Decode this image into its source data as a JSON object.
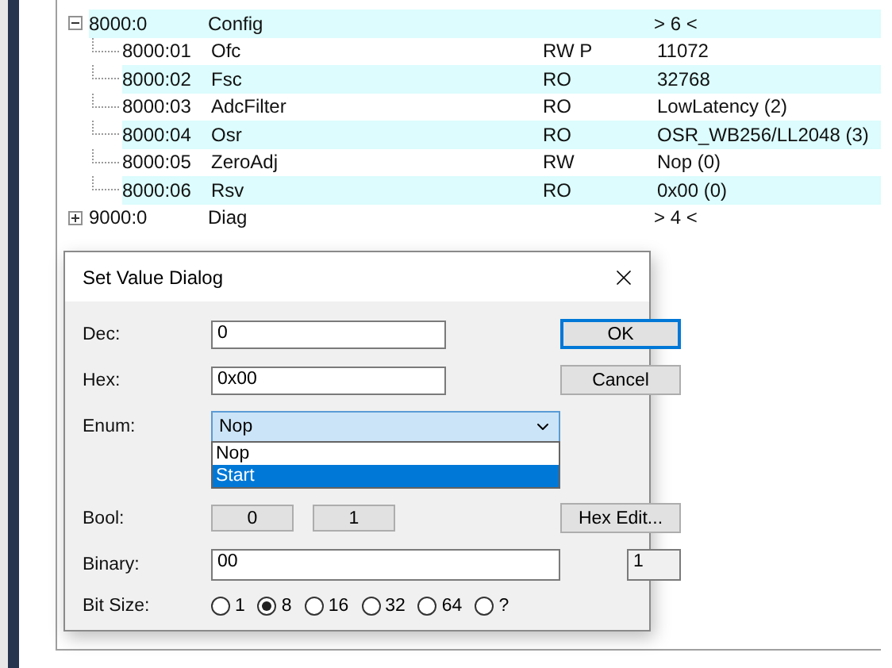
{
  "tree": [
    {
      "index": "8000:0",
      "name": "Config",
      "value": "> 6 <",
      "expanded": true,
      "highlighted": true,
      "children": [
        {
          "index": "8000:01",
          "name": "Ofc",
          "flags": "RW P",
          "value": "11072",
          "highlighted": false
        },
        {
          "index": "8000:02",
          "name": "Fsc",
          "flags": "RO",
          "value": "32768",
          "highlighted": true
        },
        {
          "index": "8000:03",
          "name": "AdcFilter",
          "flags": "RO",
          "value": "LowLatency (2)",
          "highlighted": false
        },
        {
          "index": "8000:04",
          "name": "Osr",
          "flags": "RO",
          "value": "OSR_WB256/LL2048 (3)",
          "highlighted": true
        },
        {
          "index": "8000:05",
          "name": "ZeroAdj",
          "flags": "RW",
          "value": "Nop (0)",
          "highlighted": false
        },
        {
          "index": "8000:06",
          "name": "Rsv",
          "flags": "RO",
          "value": "0x00 (0)",
          "highlighted": true
        }
      ]
    },
    {
      "index": "9000:0",
      "name": "Diag",
      "value": "> 4 <",
      "expanded": false,
      "highlighted": false
    }
  ],
  "dialog": {
    "title": "Set Value Dialog",
    "dec": {
      "label": "Dec:",
      "value": "0"
    },
    "hex": {
      "label": "Hex:",
      "value": "0x00"
    },
    "enum": {
      "label": "Enum:",
      "value": "Nop",
      "expanded": true,
      "options": [
        {
          "label": "Nop",
          "highlighted": false
        },
        {
          "label": "Start",
          "highlighted": true
        }
      ]
    },
    "bool": {
      "label": "Bool:",
      "buttons": [
        "0",
        "1"
      ]
    },
    "binary": {
      "label": "Binary:",
      "value": "00",
      "bits": "1"
    },
    "bit_size": {
      "label": "Bit Size:",
      "options": [
        {
          "label": "1",
          "selected": false
        },
        {
          "label": "8",
          "selected": true
        },
        {
          "label": "16",
          "selected": false
        },
        {
          "label": "32",
          "selected": false
        },
        {
          "label": "64",
          "selected": false
        },
        {
          "label": "?",
          "selected": false
        }
      ]
    },
    "buttons": [
      {
        "label": "OK",
        "kind": "default"
      },
      {
        "label": "Cancel",
        "kind": "normal"
      },
      {
        "label": "Hex Edit...",
        "kind": "normal"
      }
    ]
  }
}
